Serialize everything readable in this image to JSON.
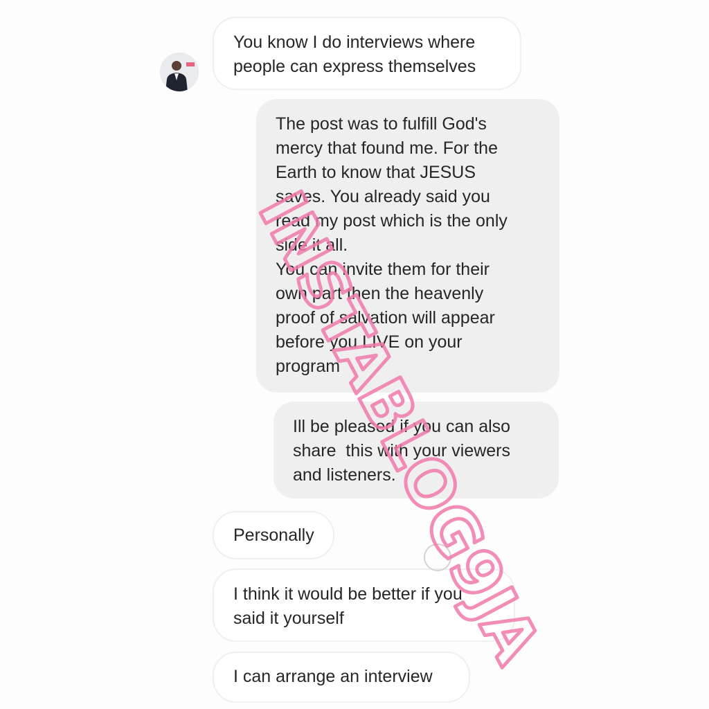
{
  "conversation": {
    "messages": [
      {
        "direction": "incoming",
        "text": "You know I do interviews where\npeople can express themselves"
      },
      {
        "direction": "outgoing",
        "text": "The post was to fulfill God's\nmercy that found me. For the\nEarth to know that JESUS\nsaves. You already said you\nread my post which is the only\nside it all.\nYou can invite them for their\nown part then the heavenly\nproof of salvation will appear\nbefore you LIVE on your\nprogram"
      },
      {
        "direction": "outgoing",
        "text": "Ill be pleased if you can also\nshare  this with your viewers\nand listeners."
      },
      {
        "direction": "incoming",
        "text": "Personally"
      },
      {
        "direction": "incoming",
        "text": "I think it would be better if you\nsaid it yourself"
      },
      {
        "direction": "incoming",
        "text": "I can arrange an interview"
      }
    ]
  },
  "watermark": {
    "text": "INSTABLOG9JA",
    "color": "#f07aaa"
  },
  "colors": {
    "incoming_bubble_bg": "#ffffff",
    "incoming_bubble_border": "#efefef",
    "outgoing_bubble_bg": "#efefef",
    "text": "#262626"
  }
}
